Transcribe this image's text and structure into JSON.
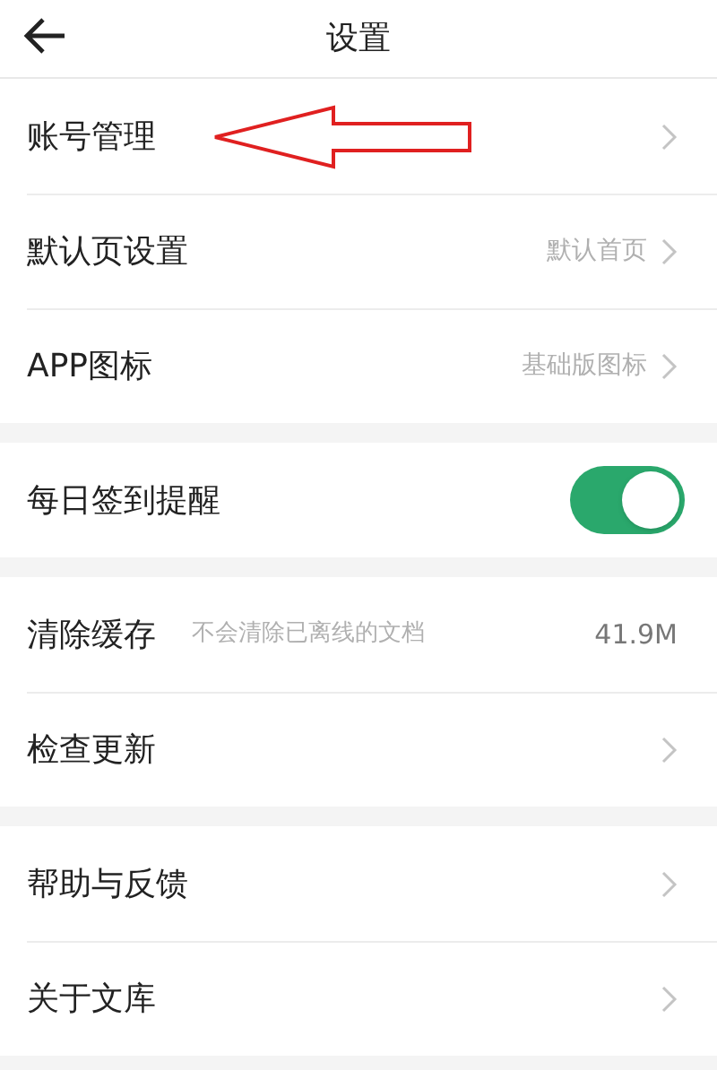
{
  "header": {
    "title": "设置"
  },
  "groups": [
    {
      "rows": [
        {
          "kind": "link",
          "label": "账号管理"
        },
        {
          "kind": "link",
          "label": "默认页设置",
          "value": "默认首页"
        },
        {
          "kind": "link",
          "label": "APP图标",
          "value": "基础版图标"
        }
      ]
    },
    {
      "rows": [
        {
          "kind": "toggle",
          "label": "每日签到提醒",
          "on": true
        }
      ]
    },
    {
      "rows": [
        {
          "kind": "info",
          "label": "清除缓存",
          "note": "不会清除已离线的文档",
          "value": "41.9M"
        },
        {
          "kind": "link",
          "label": "检查更新"
        }
      ]
    },
    {
      "rows": [
        {
          "kind": "link",
          "label": "帮助与反馈"
        },
        {
          "kind": "link",
          "label": "关于文库"
        }
      ]
    }
  ]
}
